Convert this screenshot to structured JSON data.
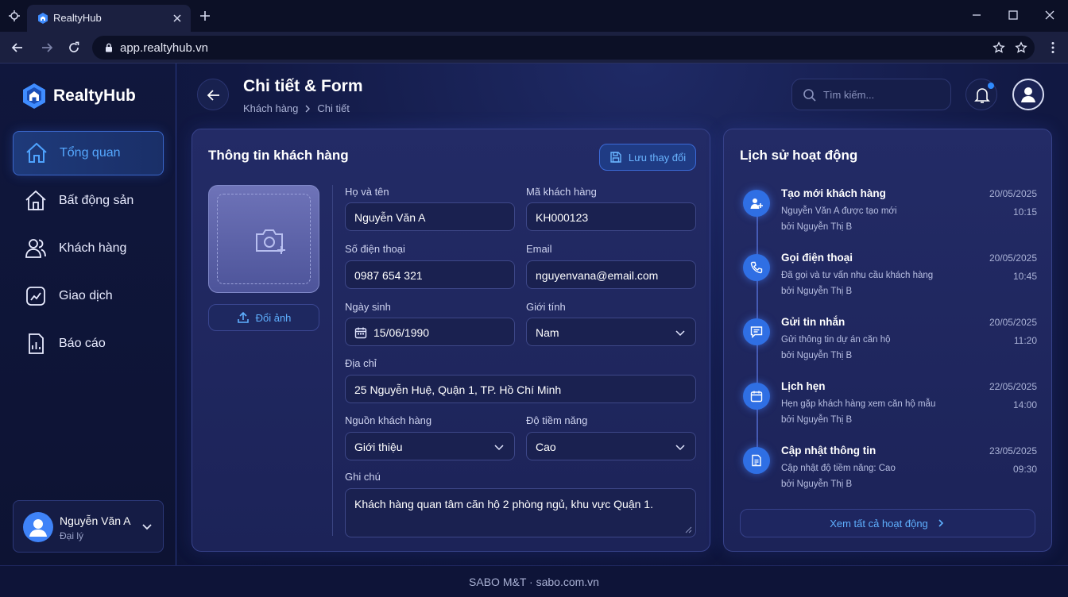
{
  "browser": {
    "tab_title": "RealtyHub",
    "url": "app.realtyhub.vn"
  },
  "brand": {
    "name": "RealtyHub"
  },
  "sidebar": {
    "items": [
      {
        "label": "Tổng quan",
        "icon": "home-icon",
        "active": true
      },
      {
        "label": "Bất động sản",
        "icon": "house-icon",
        "active": false
      },
      {
        "label": "Khách hàng",
        "icon": "users-icon",
        "active": false
      },
      {
        "label": "Giao dịch",
        "icon": "transaction-icon",
        "active": false
      },
      {
        "label": "Báo cáo",
        "icon": "report-icon",
        "active": false
      }
    ],
    "user": {
      "name": "Nguyễn Văn A",
      "role": "Đại lý"
    }
  },
  "header": {
    "title": "Chi tiết & Form",
    "breadcrumb": [
      "Khách hàng",
      "Chi tiết"
    ],
    "search_placeholder": "Tìm kiếm..."
  },
  "customer": {
    "title": "Thông tin khách hàng",
    "save_label": "Lưu thay đổi",
    "change_photo_label": "Đổi ảnh",
    "fields": {
      "name": {
        "label": "Họ và tên",
        "value": "Nguyễn Văn A"
      },
      "code": {
        "label": "Mã khách hàng",
        "value": "KH000123"
      },
      "phone": {
        "label": "Số điện thoại",
        "value": "0987 654 321"
      },
      "email": {
        "label": "Email",
        "value": "nguyenvana@email.com"
      },
      "dob": {
        "label": "Ngày sinh",
        "value": "15/06/1990"
      },
      "gender": {
        "label": "Giới tính",
        "value": "Nam"
      },
      "address": {
        "label": "Địa chỉ",
        "value": "25 Nguyễn Huệ, Quận 1, TP. Hồ Chí Minh"
      },
      "source": {
        "label": "Nguồn khách hàng",
        "value": "Giới thiệu"
      },
      "potential": {
        "label": "Độ tiềm năng",
        "value": "Cao"
      },
      "notes": {
        "label": "Ghi chú",
        "value": "Khách hàng quan tâm căn hộ 2 phòng ngủ, khu vực Quận 1."
      }
    }
  },
  "activity": {
    "title": "Lịch sử hoạt động",
    "items": [
      {
        "title": "Tạo mới khách hàng",
        "desc": "Nguyễn Văn A được tạo mới",
        "by": "bởi Nguyễn Thị B",
        "date": "20/05/2025",
        "time": "10:15",
        "icon": "user-plus-icon"
      },
      {
        "title": "Gọi điện thoại",
        "desc": "Đã gọi và tư vấn nhu cầu khách hàng",
        "by": "bởi Nguyễn Thị B",
        "date": "20/05/2025",
        "time": "10:45",
        "icon": "phone-icon"
      },
      {
        "title": "Gửi tin nhắn",
        "desc": "Gửi thông tin dự án căn hộ",
        "by": "bởi Nguyễn Thị B",
        "date": "20/05/2025",
        "time": "11:20",
        "icon": "message-icon"
      },
      {
        "title": "Lịch hẹn",
        "desc": "Hẹn gặp khách hàng xem căn hộ mẫu",
        "by": "bởi Nguyễn Thị B",
        "date": "22/05/2025",
        "time": "14:00",
        "icon": "calendar-icon"
      },
      {
        "title": "Cập nhật thông tin",
        "desc": "Cập nhật độ tiềm năng: Cao",
        "by": "bởi Nguyễn Thị B",
        "date": "23/05/2025",
        "time": "09:30",
        "icon": "document-icon"
      }
    ],
    "see_all_label": "Xem tất cả hoạt động"
  },
  "footer": {
    "text": "SABO M&T · sabo.com.vn"
  },
  "colors": {
    "accent": "#3f8cff",
    "background": "#0c1234",
    "panel": "#202862"
  }
}
